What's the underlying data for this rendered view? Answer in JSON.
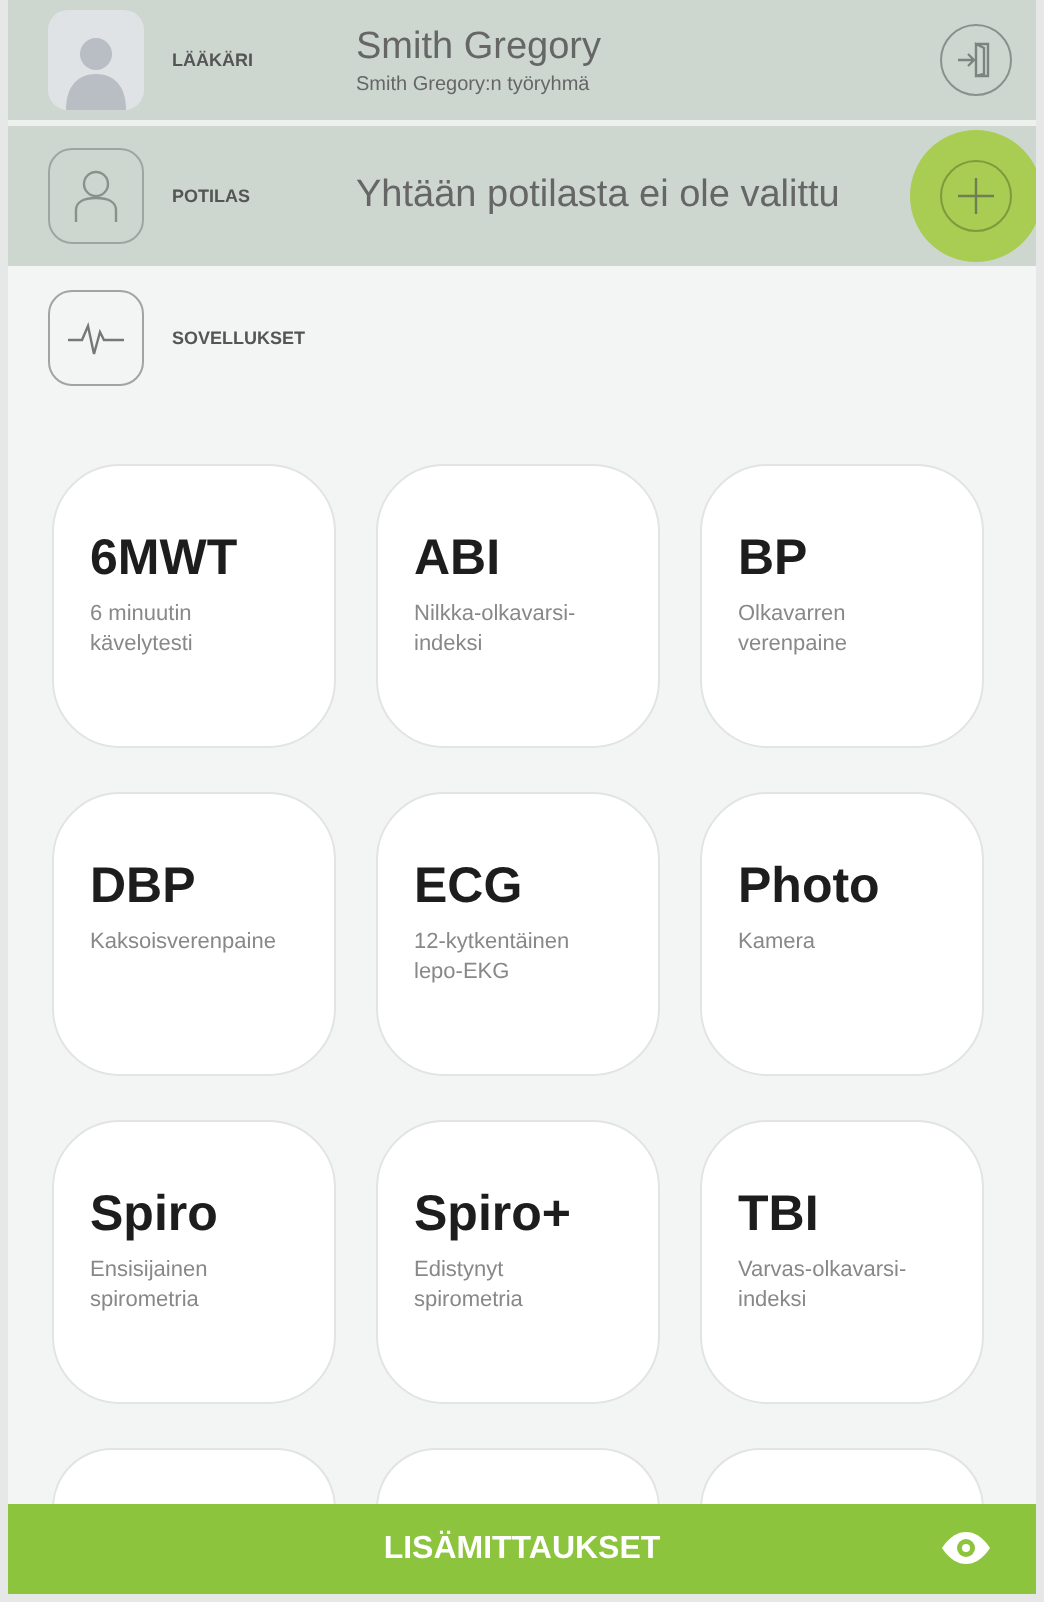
{
  "doctor": {
    "label": "LÄÄKÄRI",
    "name": "Smith Gregory",
    "team": "Smith Gregory:n työryhmä"
  },
  "patient": {
    "label": "POTILAS",
    "status": "Yhtään potilasta ei ole valittu",
    "add_highlighted": true
  },
  "apps_section": {
    "label": "SOVELLUKSET"
  },
  "apps": [
    {
      "title": "6MWT",
      "subtitle": "6 minuutin\nkävelytesti"
    },
    {
      "title": "ABI",
      "subtitle": "Nilkka-olkavarsi-\nindeksi"
    },
    {
      "title": "BP",
      "subtitle": "Olkavarren\nverenpaine"
    },
    {
      "title": "DBP",
      "subtitle": "Kaksoisverenpaine"
    },
    {
      "title": "ECG",
      "subtitle": "12-kytkentäinen\nlepo-EKG"
    },
    {
      "title": "Photo",
      "subtitle": "Kamera"
    },
    {
      "title": "Spiro",
      "subtitle": "Ensisijainen\nspirometria"
    },
    {
      "title": "Spiro+",
      "subtitle": "Edistynyt\nspirometria"
    },
    {
      "title": "TBI",
      "subtitle": "Varvas-olkavarsi-\nindeksi"
    }
  ],
  "bottom_bar": {
    "label": "LISÄMITTAUKSET"
  }
}
